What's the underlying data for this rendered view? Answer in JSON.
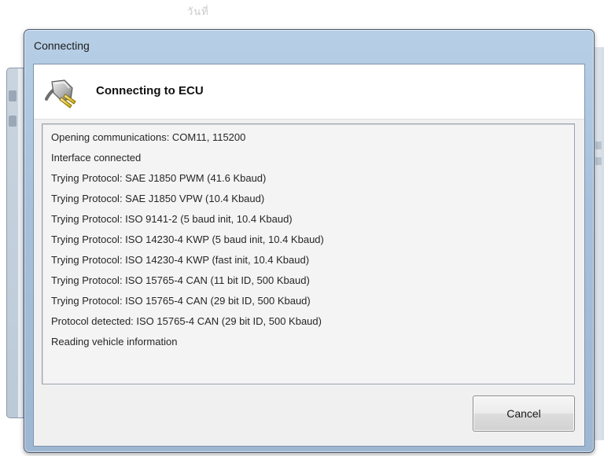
{
  "background": {
    "top_fragment": "วันที่"
  },
  "dialog": {
    "title": "Connecting",
    "header": {
      "icon": "plug-connector-icon",
      "title": "Connecting to ECU"
    },
    "log_lines": [
      "Opening communications: COM11, 115200",
      "Interface connected",
      "Trying Protocol: SAE J1850 PWM (41.6 Kbaud)",
      "Trying Protocol: SAE J1850 VPW (10.4 Kbaud)",
      "Trying Protocol: ISO 9141-2 (5 baud init, 10.4 Kbaud)",
      "Trying Protocol: ISO 14230-4 KWP (5 baud init, 10.4 Kbaud)",
      "Trying Protocol: ISO 14230-4 KWP (fast init, 10.4 Kbaud)",
      "Trying Protocol: ISO 15765-4 CAN (11 bit ID, 500 Kbaud)",
      "Trying Protocol: ISO 15765-4 CAN (29 bit ID, 500 Kbaud)",
      "Protocol detected: ISO 15765-4 CAN (29 bit ID, 500 Kbaud)",
      "Reading vehicle information"
    ],
    "cancel_label": "Cancel"
  },
  "colors": {
    "frame": "#a7c1dc",
    "client": "#f0f0f0",
    "log_background": "#f4f4f4"
  }
}
